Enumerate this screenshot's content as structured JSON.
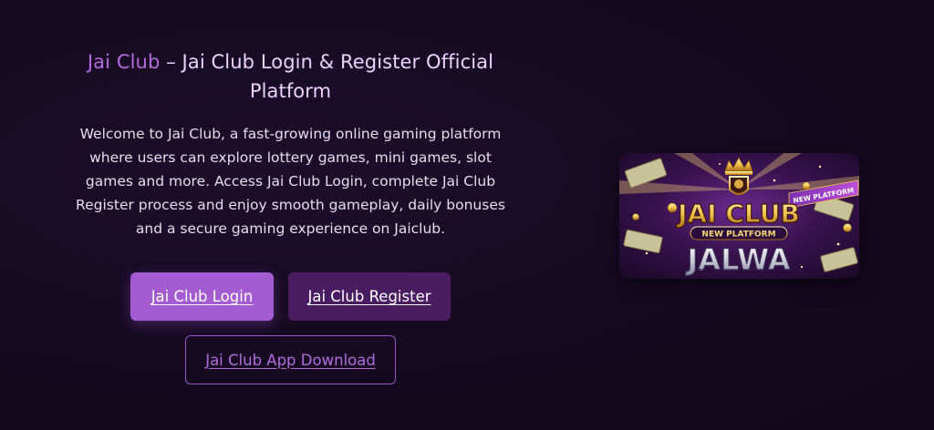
{
  "hero": {
    "title_accent": "Jai Club",
    "title_rest": " – Jai Club Login & Register Official Platform",
    "description": "Welcome to Jai Club, a fast-growing online gaming platform where users can explore lottery games, mini games, slot games and more. Access Jai Club Login, complete Jai Club Register process and enjoy smooth gameplay, daily bonuses and a secure gaming experience on Jaiclub.",
    "buttons": {
      "login_label": "Jai Club Login",
      "register_label": "Jai Club Register",
      "download_label": "Jai Club App Download"
    }
  },
  "banner": {
    "brand_text": "JAI CLUB",
    "ribbon_text": "NEW PLATFORM",
    "subtitle_text": "NEW PLATFORM",
    "bottom_text": "JALWA"
  },
  "colors": {
    "background": "#140a1f",
    "accent": "#b56ae0",
    "login_button": "#a55bd1",
    "register_button": "#4a1d63"
  }
}
